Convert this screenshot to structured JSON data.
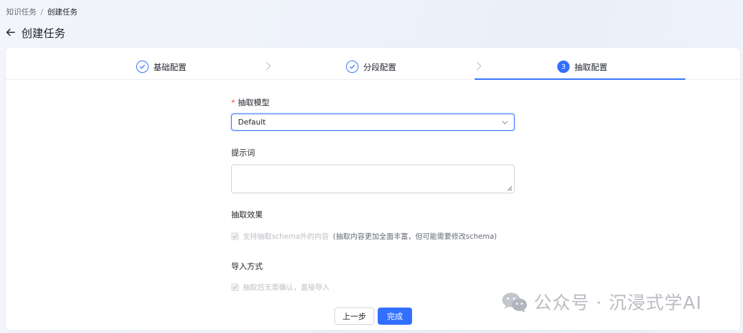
{
  "breadcrumb": {
    "parent": "知识任务",
    "separator": "/",
    "current": "创建任务"
  },
  "page": {
    "title": "创建任务"
  },
  "steps": [
    {
      "label": "基础配置",
      "status": "done"
    },
    {
      "label": "分段配置",
      "status": "done"
    },
    {
      "label": "抽取配置",
      "status": "active",
      "number": "3"
    }
  ],
  "form": {
    "model": {
      "required_mark": "*",
      "label": "抽取模型",
      "value": "Default"
    },
    "prompt": {
      "label": "提示词",
      "value": ""
    },
    "effect": {
      "label": "抽取效果",
      "option_label": "支持抽取schema外的内容",
      "option_note": "(抽取内容更加全面丰富，但可能需要修改schema)",
      "checked": true,
      "disabled": true
    },
    "import": {
      "label": "导入方式",
      "option_label": "抽取后无需确认，直接导入",
      "checked": true,
      "disabled": true
    }
  },
  "actions": {
    "prev_label": "上一步",
    "done_label": "完成"
  },
  "watermark": {
    "text": "公众号 · 沉浸式学AI"
  },
  "colors": {
    "primary": "#3370ff",
    "required": "#f54a45",
    "border": "#d0d3d6",
    "disabled_text": "#bbbfc4"
  },
  "icons": [
    "back-arrow-icon",
    "check-circle-icon",
    "step-arrow-icon",
    "chevron-down-icon",
    "resize-grip-icon",
    "checkmark-icon",
    "wechat-logo-icon"
  ]
}
